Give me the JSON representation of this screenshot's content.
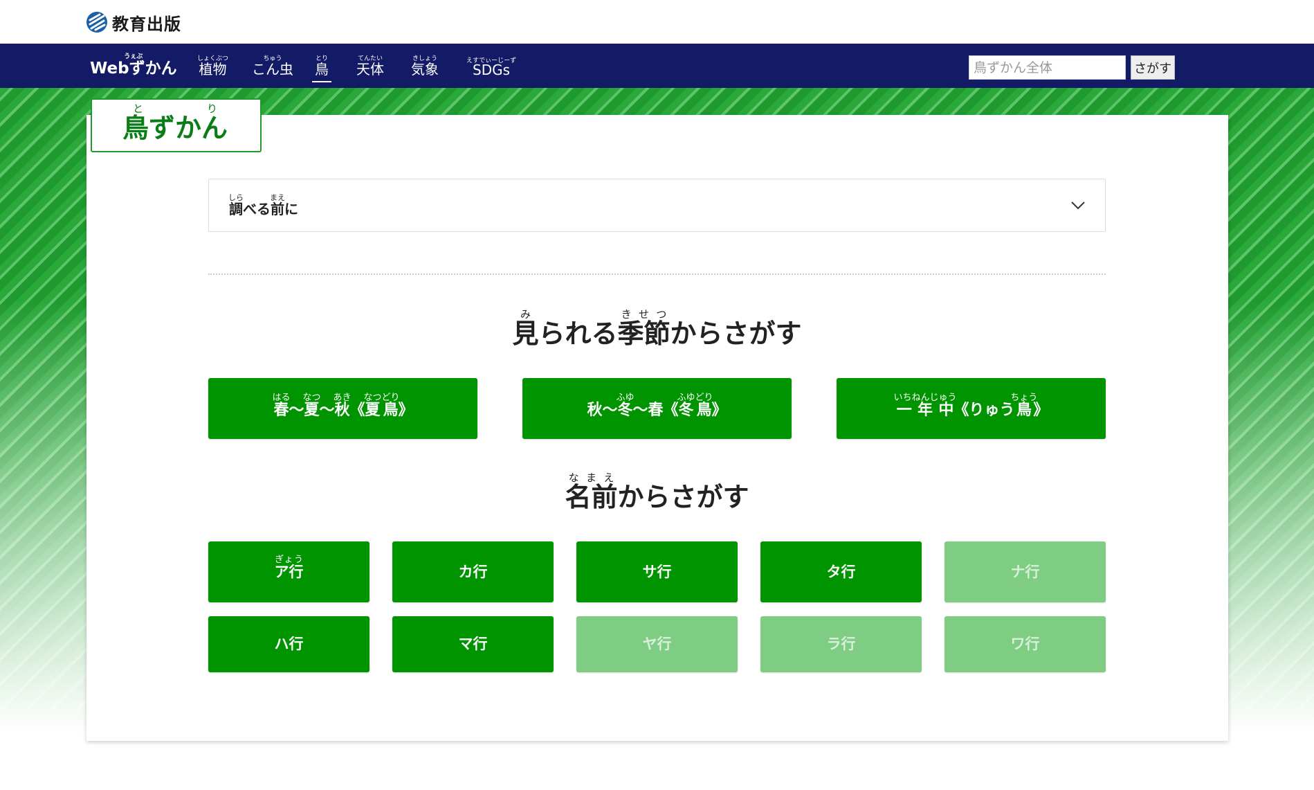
{
  "header": {
    "logo_text": "教育出版"
  },
  "nav": {
    "items": [
      {
        "base": "Webずかん",
        "ruby": "うぇぶ"
      },
      {
        "base": "植物",
        "ruby": "しょくぶつ"
      },
      {
        "base": "こん虫",
        "ruby": "ちゅう"
      },
      {
        "base": "鳥",
        "ruby": "とり"
      },
      {
        "base": "天体",
        "ruby": "てんたい"
      },
      {
        "base": "気象",
        "ruby": "きしょう"
      },
      {
        "base": "SDGs",
        "ruby": "えすでぃーじーず"
      }
    ],
    "search_placeholder": "鳥ずかん全体",
    "search_button": "さがす"
  },
  "page": {
    "title_base": "鳥ずかん",
    "title_ruby": "とり"
  },
  "accordion": {
    "label_1": "調",
    "label_1_ruby": "しら",
    "label_2": "べる",
    "label_3": "前",
    "label_3_ruby": "まえ",
    "label_4": "に"
  },
  "season_section": {
    "title_1": "見",
    "title_1_ruby": "み",
    "title_2": "られる",
    "title_3": "季節",
    "title_3_ruby": "きせつ",
    "title_4": "からさがす",
    "buttons": [
      {
        "parts": [
          {
            "b": "春",
            "r": "はる"
          },
          {
            "b": "〜"
          },
          {
            "b": "夏",
            "r": "なつ"
          },
          {
            "b": "〜"
          },
          {
            "b": "秋",
            "r": "あき"
          },
          {
            "b": "《"
          },
          {
            "b": "夏鳥",
            "r": "なつどり"
          },
          {
            "b": "》"
          }
        ]
      },
      {
        "parts": [
          {
            "b": "秋"
          },
          {
            "b": "〜"
          },
          {
            "b": "冬",
            "r": "ふゆ"
          },
          {
            "b": "〜"
          },
          {
            "b": "春"
          },
          {
            "b": "《"
          },
          {
            "b": "冬鳥",
            "r": "ふゆどり"
          },
          {
            "b": "》"
          }
        ]
      },
      {
        "parts": [
          {
            "b": "一年中",
            "r": "いちねんじゅう"
          },
          {
            "b": "《りゅう"
          },
          {
            "b": "鳥",
            "r": "ちょう"
          },
          {
            "b": "》"
          }
        ]
      }
    ]
  },
  "name_section": {
    "title_1": "名前",
    "title_1_ruby": "なまえ",
    "title_2": "からさがす",
    "gyou_ruby": "ぎょう",
    "buttons": [
      {
        "label": "ア行",
        "enabled": true
      },
      {
        "label": "カ行",
        "enabled": true
      },
      {
        "label": "サ行",
        "enabled": true
      },
      {
        "label": "タ行",
        "enabled": true
      },
      {
        "label": "ナ行",
        "enabled": false
      },
      {
        "label": "ハ行",
        "enabled": true
      },
      {
        "label": "マ行",
        "enabled": true
      },
      {
        "label": "ヤ行",
        "enabled": false
      },
      {
        "label": "ラ行",
        "enabled": false
      },
      {
        "label": "ワ行",
        "enabled": false
      }
    ]
  },
  "colors": {
    "nav_bg": "#131a66",
    "button_green": "#009400",
    "button_disabled": "#7fcd83",
    "title_green": "#0a7d16"
  }
}
